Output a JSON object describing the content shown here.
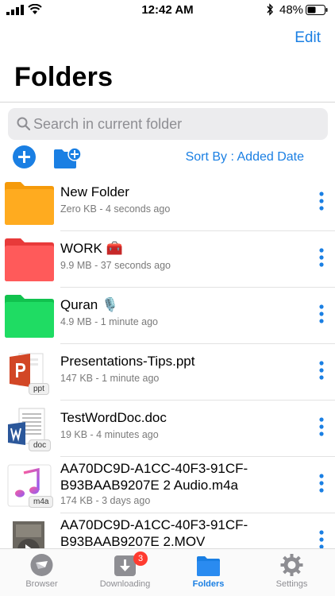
{
  "status_bar": {
    "time": "12:42 AM",
    "battery": "48%"
  },
  "nav": {
    "edit_label": "Edit",
    "title": "Folders"
  },
  "search": {
    "placeholder": "Search in current folder"
  },
  "toolbar": {
    "sort_label": "Sort By : Added Date"
  },
  "files": [
    {
      "name": "New Folder",
      "meta": "Zero KB - 4 seconds ago",
      "kind": "folder",
      "color": "#ff9f0a"
    },
    {
      "name": "WORK 🧰",
      "meta": "9.9 MB - 37 seconds ago",
      "kind": "folder",
      "color": "#ff4b4b"
    },
    {
      "name": "Quran 🎙️",
      "meta": "4.9 MB - 1 minute ago",
      "kind": "folder",
      "color": "#1ed760"
    },
    {
      "name": "Presentations-Tips.ppt",
      "meta": "147 KB - 1 minute ago",
      "kind": "ppt",
      "badge": "ppt"
    },
    {
      "name": "TestWordDoc.doc",
      "meta": "19 KB - 4 minutes ago",
      "kind": "doc",
      "badge": "doc"
    },
    {
      "name": "AA70DC9D-A1CC-40F3-91CF-B93BAAB9207E 2 Audio.m4a",
      "meta": "174 KB - 3 days ago",
      "kind": "audio",
      "badge": "m4a"
    },
    {
      "name": "AA70DC9D-A1CC-40F3-91CF-B93BAAB9207E 2.MOV",
      "meta": "",
      "kind": "video"
    }
  ],
  "tabs": [
    {
      "label": "Browser",
      "icon": "compass-icon"
    },
    {
      "label": "Downloading",
      "icon": "download-icon",
      "badge": "3"
    },
    {
      "label": "Folders",
      "icon": "folder-icon",
      "active": true
    },
    {
      "label": "Settings",
      "icon": "gear-icon"
    }
  ],
  "colors": {
    "accent": "#1a7fe3",
    "badge": "#ff3b30"
  }
}
